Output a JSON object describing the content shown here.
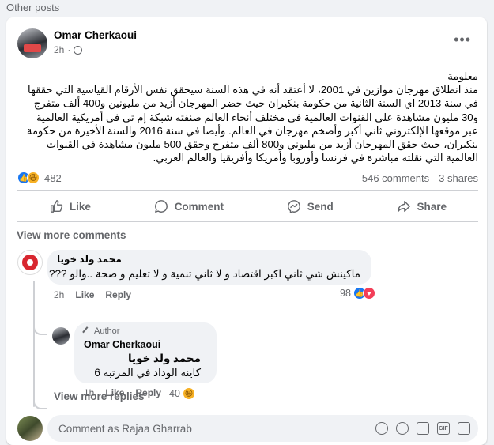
{
  "section_title": "Other posts",
  "post": {
    "author": "Omar Cherkaoui",
    "time": "2h",
    "privacy_icon": "globe-icon",
    "text_lines": [
      "معلومة",
      "منذ انطلاق مهرجان موازين في 2001، لا أعتقد أنه في هذه السنة سيحقق نفس الأرقام القياسية التي حققها",
      "في سنة 2013 اي السنة الثانية من حكومة بنكيران حيث حضر المهرجان أزيد من مليونين و400 ألف متفرج",
      "و30 مليون مشاهدة على القنوات العالمية في مختلف أنحاء العالم صنفته شبكة إم تي في أمريكية العالمية",
      "عبر موقعها الإلكتروني ثاني أكبر وأضخم مهرجان في العالم. وأيضا في سنة 2016 والسنة الأخيرة من حكومة",
      "بنكيران، حيث حقق المهرجان أزيد من مليوني و800 ألف متفرج وحقق 500 مليون مشاهدة في القنوات",
      "العالمية التي نقلته مباشرة في فرنسا وأوروبا وأمريكا وأفريقيا والعالم العربي."
    ],
    "reaction_count": "482",
    "comments_count": "546 comments",
    "shares_count": "3 shares"
  },
  "actions": {
    "like": "Like",
    "comment": "Comment",
    "send": "Send",
    "share": "Share"
  },
  "view_more_comments": "View more comments",
  "comment1": {
    "author": "محمد ولد خويا",
    "text": "ماكينش شي ثاني اكبر اقتصاد و لا ثاني تنمية و لا تعليم و صحة ..والو ???",
    "time": "2h",
    "like": "Like",
    "reply": "Reply",
    "reaction_count": "98"
  },
  "reply1": {
    "badge": "Author",
    "author": "Omar Cherkaoui",
    "mention": "محمد ولد خويا",
    "text": "كاينة الوداد في المرتبة 6",
    "time": "1h",
    "like": "Like",
    "reply": "Reply",
    "reaction_count": "40"
  },
  "view_more_replies": "View more replies",
  "composer": {
    "placeholder": "Comment as Rajaa Gharrab",
    "icons": [
      "avatar-sticker-icon",
      "emoji-icon",
      "camera-icon",
      "gif-icon",
      "sticker-icon"
    ]
  },
  "colors": {
    "accent": "#1877f2",
    "background": "#f0f2f5",
    "secondary_text": "#65676b"
  }
}
